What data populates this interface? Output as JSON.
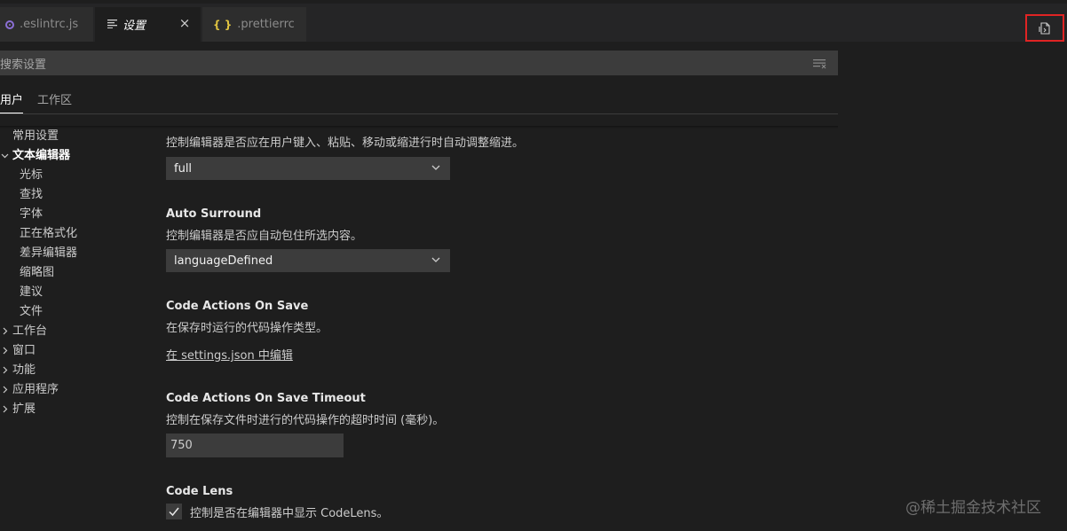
{
  "tabs": [
    {
      "label": ".eslintrc.js",
      "icon": "eslint-icon"
    },
    {
      "label": "设置",
      "icon": "settings-lines-icon",
      "active": true
    },
    {
      "label": ".prettierrc",
      "icon": "braces-icon"
    }
  ],
  "tab_close_glyph": "×",
  "search": {
    "placeholder": "搜索设置"
  },
  "scope_tabs": {
    "user": "用户",
    "workspace": "工作区"
  },
  "toc": {
    "common": "常用设置",
    "text_editor": "文本编辑器",
    "cursor": "光标",
    "find": "查找",
    "font": "字体",
    "formatting": "正在格式化",
    "diff_editor": "差异编辑器",
    "minimap": "缩略图",
    "suggestions": "建议",
    "files": "文件",
    "workbench": "工作台",
    "window": "窗口",
    "features": "功能",
    "application": "应用程序",
    "extensions": "扩展"
  },
  "settings": {
    "auto_indent": {
      "description": "控制编辑器是否应在用户键入、粘贴、移动或缩进行时自动调整缩进。",
      "value": "full"
    },
    "auto_surround": {
      "title": "Auto Surround",
      "description": "控制编辑器是否应自动包住所选内容。",
      "value": "languageDefined"
    },
    "code_actions_on_save": {
      "title": "Code Actions On Save",
      "description": "在保存时运行的代码操作类型。",
      "link": "在 settings.json 中编辑"
    },
    "code_actions_on_save_timeout": {
      "title": "Code Actions On Save Timeout",
      "description": "控制在保存文件时进行的代码操作的超时时间 (毫秒)。",
      "value": "750"
    },
    "code_lens": {
      "title": "Code Lens",
      "description": "控制是否在编辑器中显示 CodeLens。",
      "checked": true
    }
  },
  "watermark": "@稀土掘金技术社区",
  "colors": {
    "highlight_border": "#e02424",
    "accent_purple": "#8b6fd6",
    "accent_yellow": "#e2c541"
  }
}
